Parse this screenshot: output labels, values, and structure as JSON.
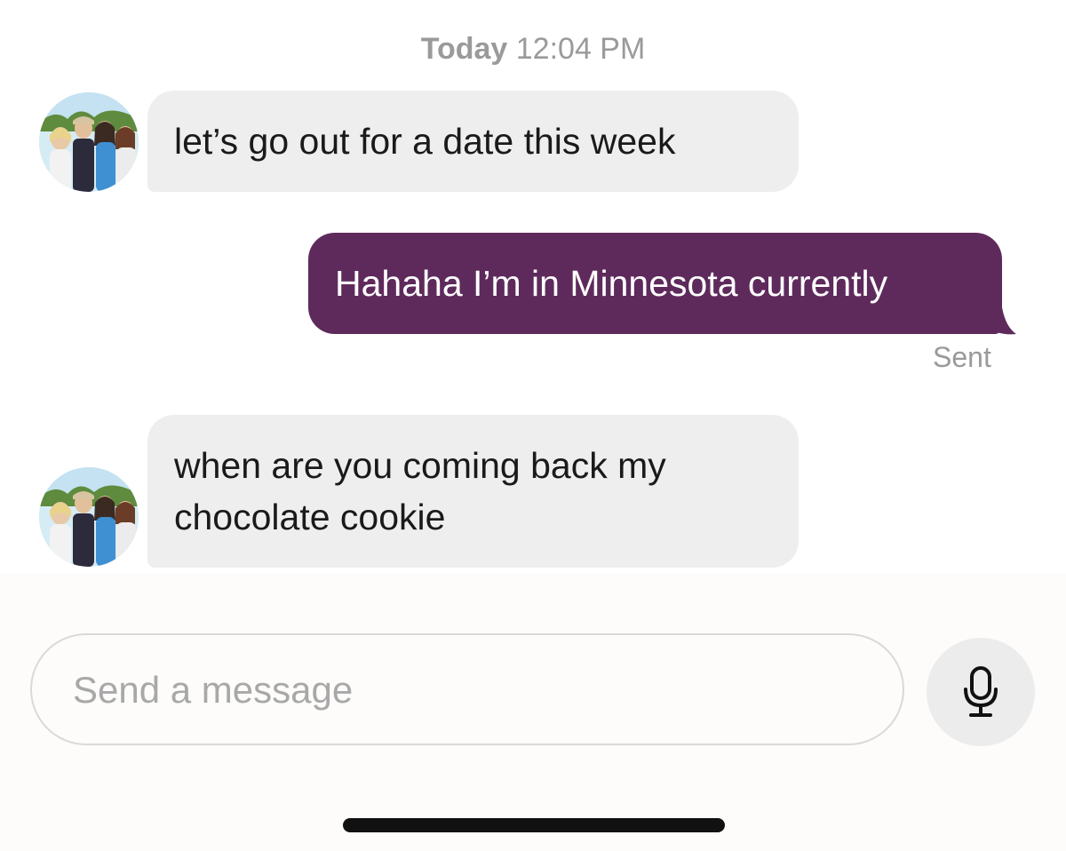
{
  "thread": {
    "timestamp": {
      "day": "Today",
      "time": "12:04 PM"
    },
    "messages": [
      {
        "direction": "incoming",
        "text": "let’s go out for a date this week",
        "avatar_icon": "contact-avatar-photo"
      },
      {
        "direction": "outgoing",
        "text": "Hahaha I’m in Minnesota currently",
        "status": "Sent"
      },
      {
        "direction": "incoming",
        "text": "when are you coming back my chocolate cookie",
        "avatar_icon": "contact-avatar-photo"
      }
    ]
  },
  "composer": {
    "placeholder": "Send a message",
    "value": "",
    "mic_icon": "microphone-icon"
  },
  "colors": {
    "outgoing_bubble": "#5e2a5c",
    "incoming_bubble": "#eeeeef",
    "meta_text": "#9a9a9a"
  }
}
